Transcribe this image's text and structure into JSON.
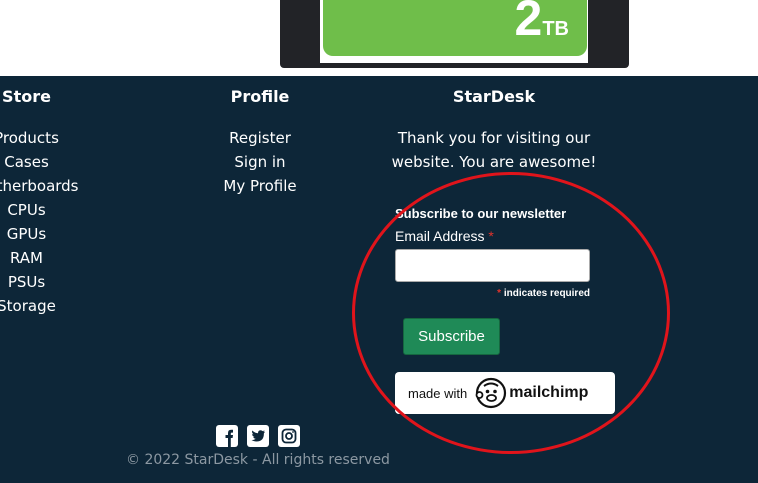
{
  "hero": {
    "drive_capacity": "2",
    "drive_unit": "TB"
  },
  "footer": {
    "store": {
      "heading": "Store",
      "items": [
        "Products",
        "Cases",
        "Motherboards",
        "CPUs",
        "GPUs",
        "RAM",
        "PSUs",
        "Storage"
      ]
    },
    "profile": {
      "heading": "Profile",
      "items": [
        "Register",
        "Sign in",
        "My Profile"
      ]
    },
    "stardesk": {
      "heading": "StarDesk",
      "text": "Thank you for visiting our website. You are awesome!"
    },
    "newsletter": {
      "title": "Subscribe to our newsletter",
      "email_label": "Email Address",
      "required_star": "*",
      "email_value": "",
      "required_note": "indicates required",
      "subscribe_label": "Subscribe",
      "badge_made_with": "made with",
      "badge_brand": "mailchimp"
    },
    "social_icons": [
      "facebook-icon",
      "twitter-icon",
      "instagram-icon"
    ],
    "copyright": "© 2022 StarDesk - All rights reserved"
  },
  "colors": {
    "footer_bg": "#0d2638",
    "button_green": "#1f8a57",
    "required_red": "#e0332c",
    "highlight_red": "#e0141b",
    "drive_green": "#6fbe4a"
  }
}
